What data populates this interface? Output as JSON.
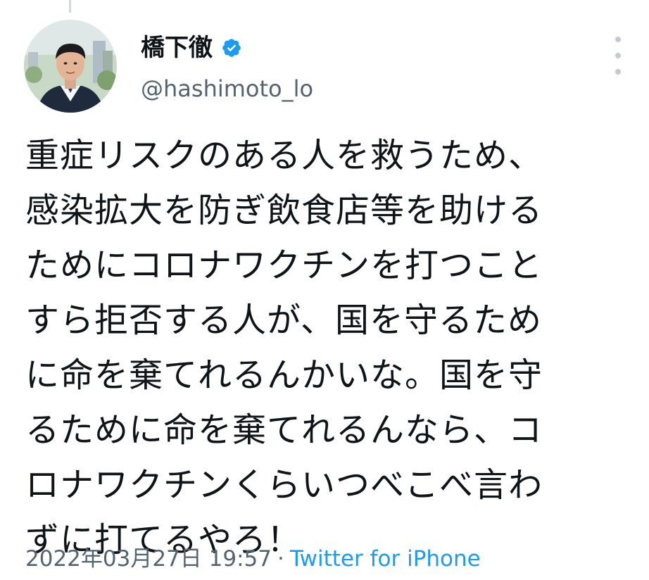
{
  "tweet": {
    "display_name": "橋下徹",
    "handle": "@hashimoto_lo",
    "verified": true,
    "text": "重症リスクのある人を救うため、\n感染拡大を防ぎ飲食店等を助ける\nためにコロナワクチンを打つこと\nすら拒否する人が、国を守るため\nに命を棄てれるんかいな。国を守\nるために命を棄てれるんなら、コ\nロナワクチンくらいつべこべ言わ\nずに打てるやろ！",
    "timestamp": "2022年03月27日 19:57",
    "separator": "·",
    "source": "Twitter for iPhone"
  },
  "icons": {
    "verified": "verified-badge-icon",
    "more": "more-vertical-icon",
    "avatar": "profile-photo"
  },
  "colors": {
    "brand_blue": "#1d9bf0",
    "secondary_text": "#536471",
    "primary_text": "#0f1419"
  }
}
